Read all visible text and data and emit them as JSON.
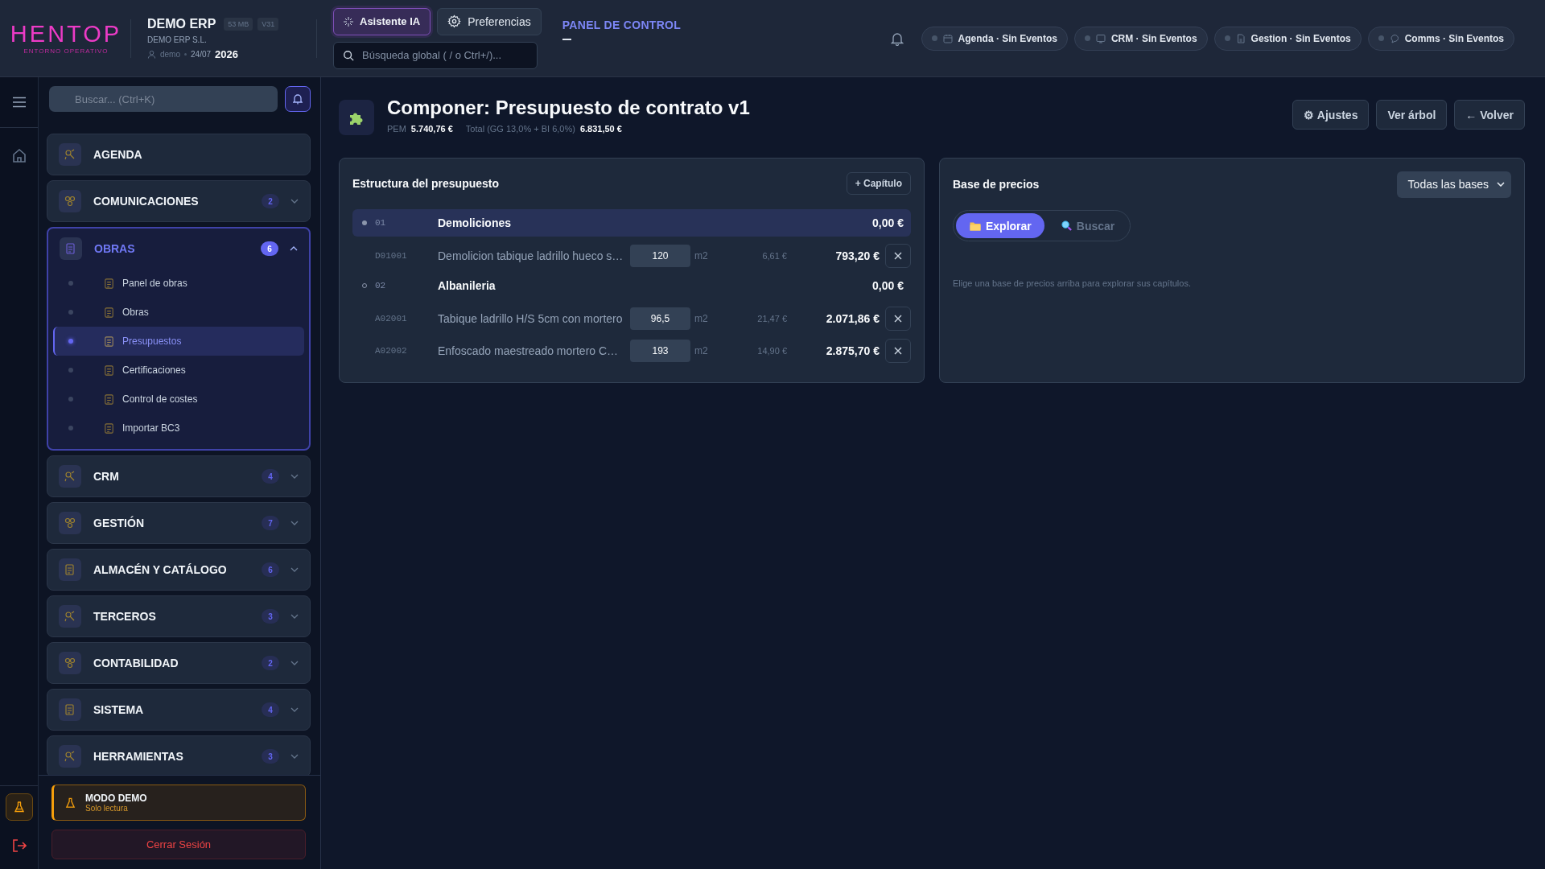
{
  "header": {
    "logo": {
      "wordmark": "HENTOP",
      "tagline": "ENTORNO OPERATIVO"
    },
    "app": {
      "name": "DEMO ERP",
      "badges": [
        "53 MB",
        "V31"
      ],
      "company": "DEMO ERP S.L.",
      "user": "demo",
      "date": "24/07",
      "year": "2026"
    },
    "buttons": [
      {
        "label": "Asistente IA",
        "kind": "ai"
      },
      {
        "label": "Preferencias",
        "kind": "settings"
      }
    ],
    "search": {
      "placeholder": "Búsqueda global ( / o Ctrl+/)..."
    },
    "panel_link": "PANEL DE CONTROL",
    "status_pills": [
      {
        "label": "Agenda · Sin Eventos"
      },
      {
        "label": "CRM · Sin Eventos"
      },
      {
        "label": "Gestion · Sin Eventos"
      },
      {
        "label": "Comms · Sin Eventos"
      }
    ]
  },
  "sidebar": {
    "search": {
      "placeholder": "Buscar... (Ctrl+K)"
    },
    "groups": [
      {
        "label": "AGENDA",
        "selected": false
      },
      {
        "label": "COMUNICACIONES",
        "count": "2",
        "selected": false,
        "expanded": false
      },
      {
        "label": "OBRAS",
        "count": "6",
        "selected": true,
        "expanded": true,
        "children": [
          {
            "label": "Panel de obras",
            "selected": false
          },
          {
            "label": "Obras",
            "selected": false
          },
          {
            "label": "Presupuestos",
            "selected": true
          },
          {
            "label": "Certificaciones",
            "selected": false
          },
          {
            "label": "Control de costes",
            "selected": false
          },
          {
            "label": "Importar BC3",
            "selected": false
          }
        ]
      },
      {
        "label": "CRM",
        "count": "4",
        "selected": false,
        "expanded": false
      },
      {
        "label": "GESTIÓN",
        "count": "7",
        "selected": false,
        "expanded": false
      },
      {
        "label": "ALMACÉN Y CATÁLOGO",
        "count": "6",
        "selected": false,
        "expanded": false
      },
      {
        "label": "TERCEROS",
        "count": "3",
        "selected": false,
        "expanded": false
      },
      {
        "label": "CONTABILIDAD",
        "count": "2",
        "selected": false,
        "expanded": false
      },
      {
        "label": "SISTEMA",
        "count": "4",
        "selected": false,
        "expanded": false
      },
      {
        "label": "HERRAMIENTAS",
        "count": "3",
        "selected": false,
        "expanded": false
      }
    ],
    "demo_notice": {
      "title": "MODO DEMO",
      "subtitle": "Solo lectura"
    },
    "logout_button": "Cerrar Sesión"
  },
  "page": {
    "title": "Componer: Presupuesto de contrato v1",
    "summary": {
      "pem_label": "PEM",
      "pem": "5.740,76 €",
      "total_label": "Total (GG 13,0% + BI 6,0%)",
      "total": "6.831,50 €"
    },
    "actions": [
      "⚙ Ajustes",
      "Ver árbol",
      "← Volver"
    ]
  },
  "structure": {
    "title": "Estructura del presupuesto",
    "add_button": "+ Capítulo",
    "rows": [
      {
        "kind": "chapter",
        "code": "01",
        "name": "Demoliciones",
        "total": "0,00 €",
        "selected": true
      },
      {
        "kind": "item",
        "code": "D01001",
        "name": "Demolicion tabique ladrillo hueco s…",
        "qty": "120",
        "unit": "m2",
        "price": "6,61 €",
        "total": "793,20 €"
      },
      {
        "kind": "chapter",
        "code": "02",
        "name": "Albanileria",
        "total": "0,00 €",
        "selected": false
      },
      {
        "kind": "item",
        "code": "A02001",
        "name": "Tabique ladrillo H/S 5cm con mortero",
        "qty": "96,5",
        "unit": "m2",
        "price": "21,47 €",
        "total": "2.071,86 €"
      },
      {
        "kind": "item",
        "code": "A02002",
        "name": "Enfoscado maestreado mortero C…",
        "qty": "193",
        "unit": "m2",
        "price": "14,90 €",
        "total": "2.875,70 €"
      }
    ]
  },
  "price_base": {
    "title": "Base de precios",
    "select": "Todas las bases",
    "tabs": [
      {
        "label": "Explorar",
        "selected": true
      },
      {
        "label": "Buscar",
        "selected": false
      }
    ],
    "empty_text": "Elige una base de precios arriba para explorar sus capítulos."
  }
}
